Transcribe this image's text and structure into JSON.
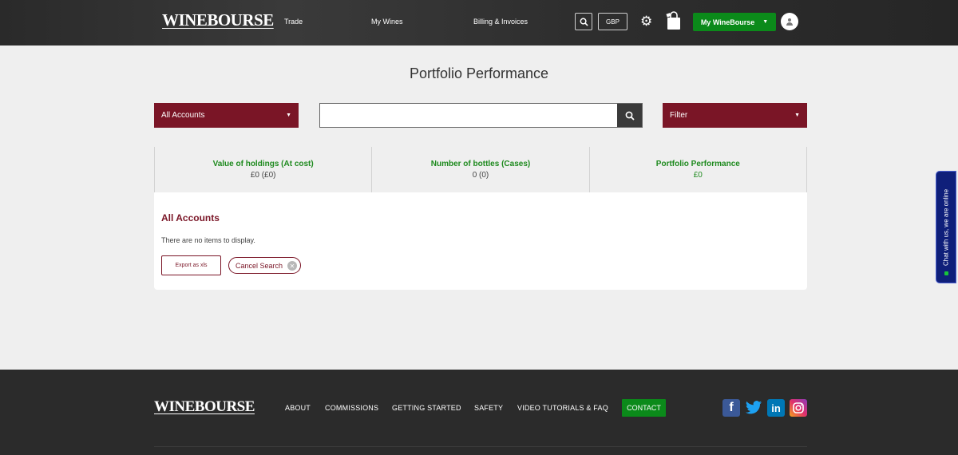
{
  "header": {
    "logo": "WINEBOURSE",
    "nav": [
      "Trade",
      "My Wines",
      "Billing & Invoices"
    ],
    "currency": "GBP",
    "account_button": "My WineBourse",
    "icons": [
      "search-icon",
      "gear-icon",
      "shopping-bag-icon",
      "user-icon"
    ]
  },
  "main": {
    "title": "Portfolio Performance",
    "accounts_select": "All Accounts",
    "search": {
      "value": "",
      "placeholder": ""
    },
    "filter_select": "Filter",
    "stats": [
      {
        "label": "Value of holdings (At cost)",
        "value": "£0 (£0)"
      },
      {
        "label": "Number of bottles (Cases)",
        "value": "0 (0)"
      },
      {
        "label": "Portfolio Performance",
        "value": "£0"
      }
    ],
    "section_title": "All Accounts",
    "empty_message": "There are no items to display.",
    "export_button": "Export as xls",
    "cancel_search": "Cancel Search"
  },
  "chat": {
    "label": "Chat with us, we are online"
  },
  "footer": {
    "logo": "WINEBOURSE",
    "links": [
      "ABOUT",
      "COMMISSIONS",
      "GETTING STARTED",
      "SAFETY",
      "VIDEO TUTORIALS & FAQ"
    ],
    "contact": "CONTACT",
    "social": [
      "facebook-icon",
      "twitter-icon",
      "linkedin-icon",
      "instagram-icon"
    ]
  },
  "colors": {
    "brand": "#7a1526",
    "accent_green": "#0b8a1a",
    "chat": "#0f1f7a"
  }
}
